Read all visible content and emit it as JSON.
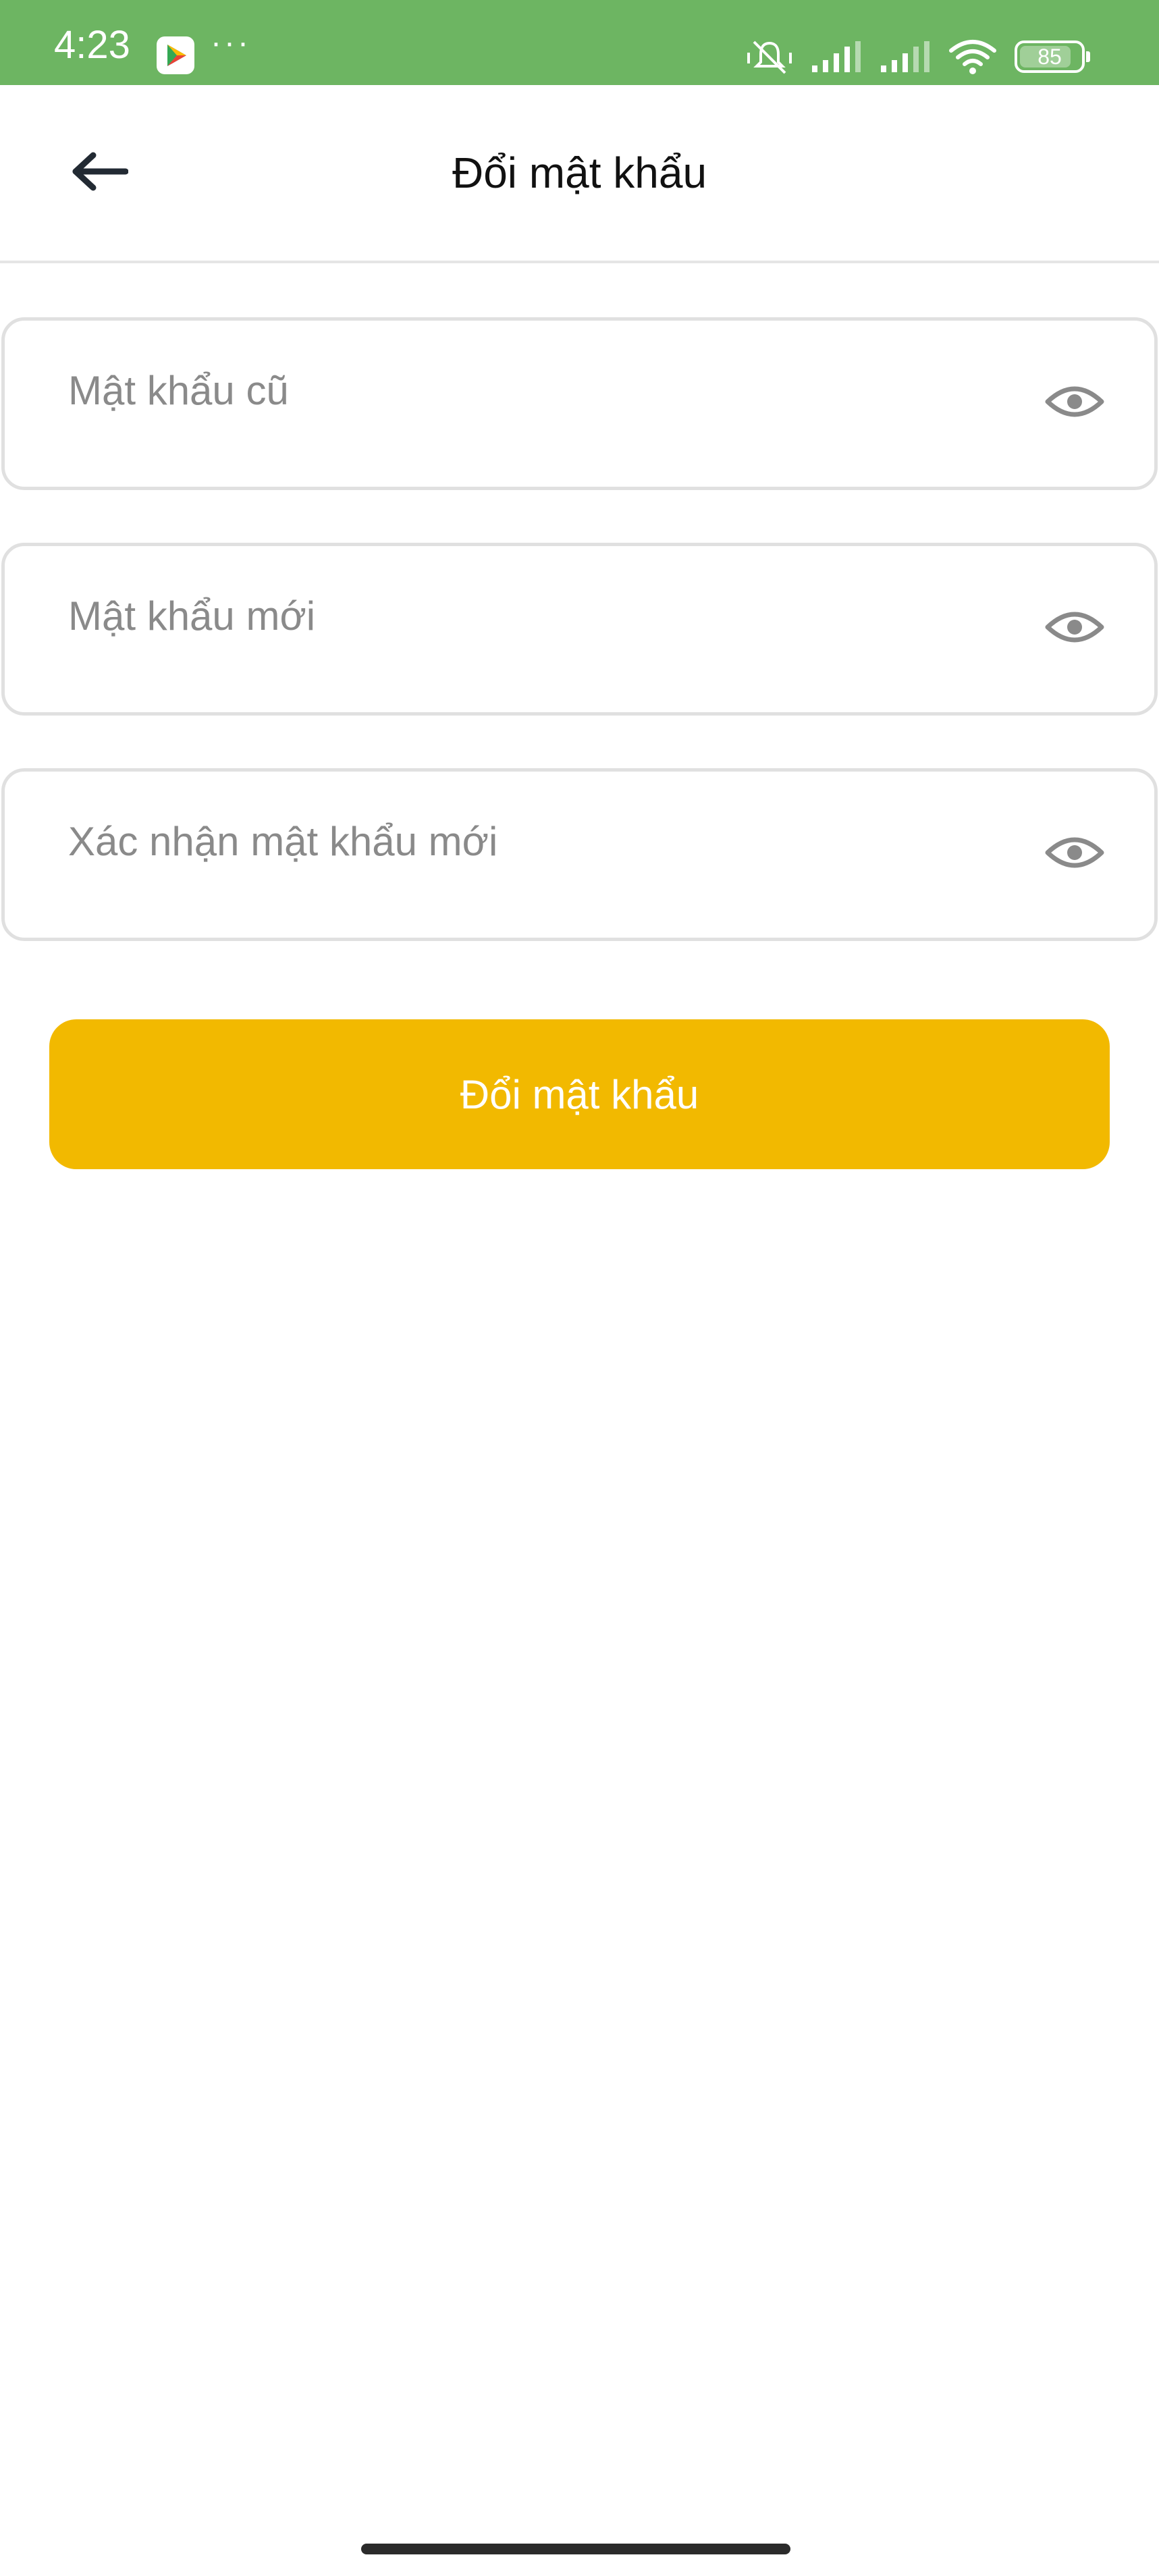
{
  "status_bar": {
    "time": "4:23",
    "more_dots": "···",
    "battery": "85",
    "battery_level": 0.85,
    "icons": [
      "play-store-icon",
      "mute-vibrate-icon",
      "signal-icon",
      "signal-icon",
      "wifi-icon",
      "battery-icon"
    ]
  },
  "header": {
    "title": "Đổi mật khẩu",
    "back_icon": "arrow-left-icon"
  },
  "form": {
    "old_password": {
      "placeholder": "Mật khẩu cũ",
      "value": ""
    },
    "new_password": {
      "placeholder": "Mật khẩu mới",
      "value": ""
    },
    "confirm_password": {
      "placeholder": "Xác nhận mật khẩu mới",
      "value": ""
    },
    "toggle_icon": "eye-icon",
    "submit_label": "Đổi mật khẩu"
  },
  "colors": {
    "status_bar": "#6db562",
    "primary_button": "#f2b900",
    "field_border": "#e0e0e0",
    "placeholder": "#8a8a8a"
  }
}
